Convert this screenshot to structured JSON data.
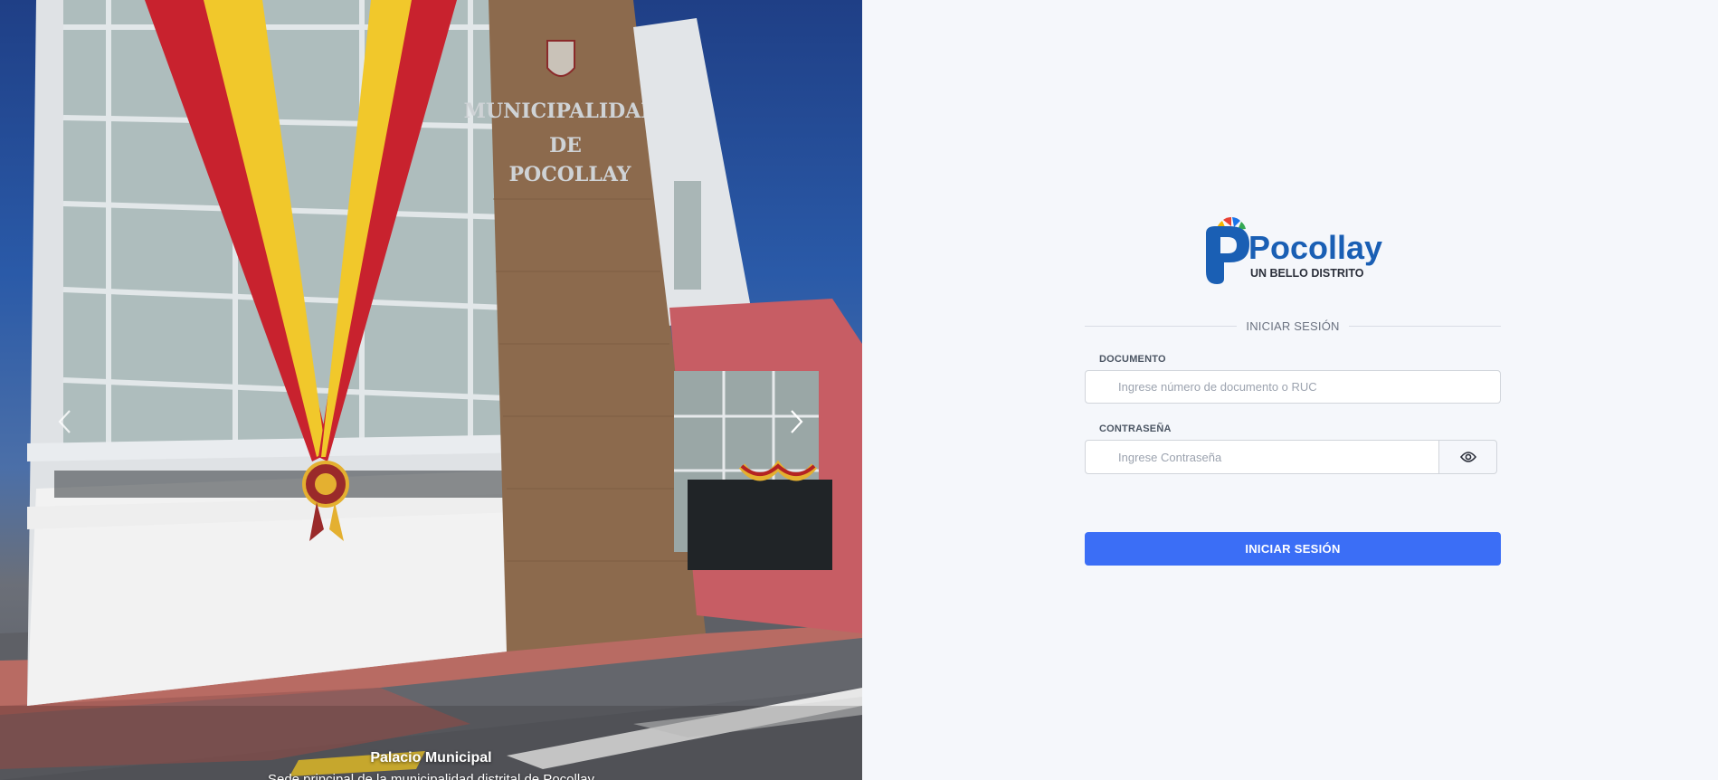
{
  "carousel": {
    "caption_title": "Palacio Municipal",
    "caption_subtitle": "Sede principal de la municipalidad distrital de Pocollay",
    "building_sign": [
      "MUNICIPALIDAD",
      "DE",
      "POCOLLAY"
    ],
    "prev_icon": "chevron-left-icon",
    "next_icon": "chevron-right-icon"
  },
  "brand": {
    "logo_wordmark": "Pocollay",
    "logo_tagline": "UN BELLO DISTRITO",
    "colors": {
      "primary": "#1a5fb4",
      "accent": "#3b6ef6"
    }
  },
  "login": {
    "heading": "INICIAR SESIÓN",
    "document_label": "DOCUMENTO",
    "document_placeholder": "Ingrese número de documento o RUC",
    "document_value": "",
    "password_label": "CONTRASEÑA",
    "password_placeholder": "Ingrese Contraseña",
    "password_value": "",
    "toggle_icon": "eye-icon",
    "submit_label": "INICIAR SESIÓN"
  }
}
